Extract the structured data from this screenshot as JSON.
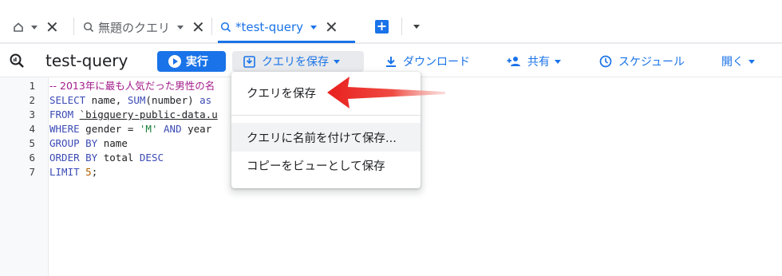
{
  "tabs": [
    {
      "label": ""
    },
    {
      "label": "無題のクエリ"
    },
    {
      "label": "*test-query"
    }
  ],
  "toolbar": {
    "title": "test-query",
    "run_label": "実行",
    "save_label": "クエリを保存",
    "download_label": "ダウンロード",
    "share_label": "共有",
    "schedule_label": "スケジュール",
    "open_label": "開く"
  },
  "editor": {
    "line_numbers": [
      "1",
      "2",
      "3",
      "4",
      "5",
      "6",
      "7"
    ],
    "line1_comment": "-- 2013年に最も人気だった男性の名",
    "line2": {
      "kw": "SELECT",
      "a": " name, ",
      "fn": "SUM",
      "b": "(number) ",
      "kw2": "as"
    },
    "line3": {
      "kw": "FROM",
      "a": " ",
      "tick": "`bigquery-public-data.u"
    },
    "line4": {
      "kw": "WHERE",
      "a": " gender = ",
      "str": "'M'",
      "b": " ",
      "kw2": "AND",
      "c": " year"
    },
    "line5": {
      "kw": "GROUP BY",
      "a": " name"
    },
    "line6": {
      "kw": "ORDER BY",
      "a": " total ",
      "kw2": "DESC"
    },
    "line7": {
      "kw": "LIMIT",
      "a": " ",
      "num": "5",
      "b": ";"
    }
  },
  "menu": {
    "items": [
      {
        "label": "クエリを保存"
      },
      {
        "label": "クエリに名前を付けて保存..."
      },
      {
        "label": "コピーをビューとして保存"
      }
    ]
  },
  "colors": {
    "accent": "#1a73e8",
    "annotation_arrow": "#e8201f"
  }
}
